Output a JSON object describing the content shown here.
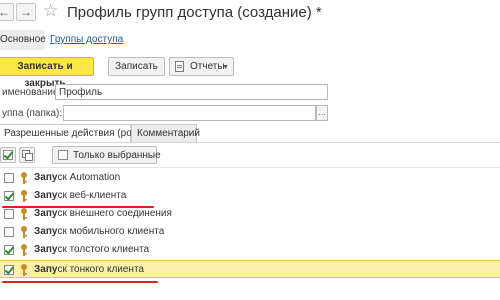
{
  "window": {
    "title": "Профиль групп доступа (создание) *",
    "back_glyph": "←",
    "forward_glyph": "→",
    "favorite_glyph": "☆"
  },
  "tabs": {
    "main": "Основное",
    "groups": "Группы доступа"
  },
  "toolbar": {
    "save_close": "Записать и закрыть",
    "save": "Записать",
    "reports": "Отчеты"
  },
  "fields": {
    "name_label": "именование:",
    "name_value": "Профиль",
    "group_label": "уппа (папка):",
    "group_value": "",
    "group_picker": "..."
  },
  "subtabs": {
    "actions": "Разрешенные действия (роли)",
    "comment": "Комментарий"
  },
  "list_toolbar": {
    "only_selected": "Только выбранные"
  },
  "roles": [
    {
      "prefix": "Запу",
      "rest": "ск Automation",
      "checked": false
    },
    {
      "prefix": "Запу",
      "rest": "ск веб-клиента",
      "checked": true
    },
    {
      "prefix": "Запу",
      "rest": "ск внешнего соединения",
      "checked": false
    },
    {
      "prefix": "Запу",
      "rest": "ск мобильного клиента",
      "checked": false
    },
    {
      "prefix": "Запу",
      "rest": "ск толстого клиента",
      "checked": true
    },
    {
      "prefix": "Запу",
      "rest": "ск тонкого клиента",
      "checked": true,
      "selected": true
    }
  ],
  "colors": {
    "primary_button": "#fbe74a",
    "selected_row": "#fbf1a9",
    "link": "#1a5fa8",
    "annotation": "#e02020",
    "key_icon": "#c98a2a"
  },
  "icons": {
    "reports": "document-icon",
    "role": "key-icon"
  }
}
